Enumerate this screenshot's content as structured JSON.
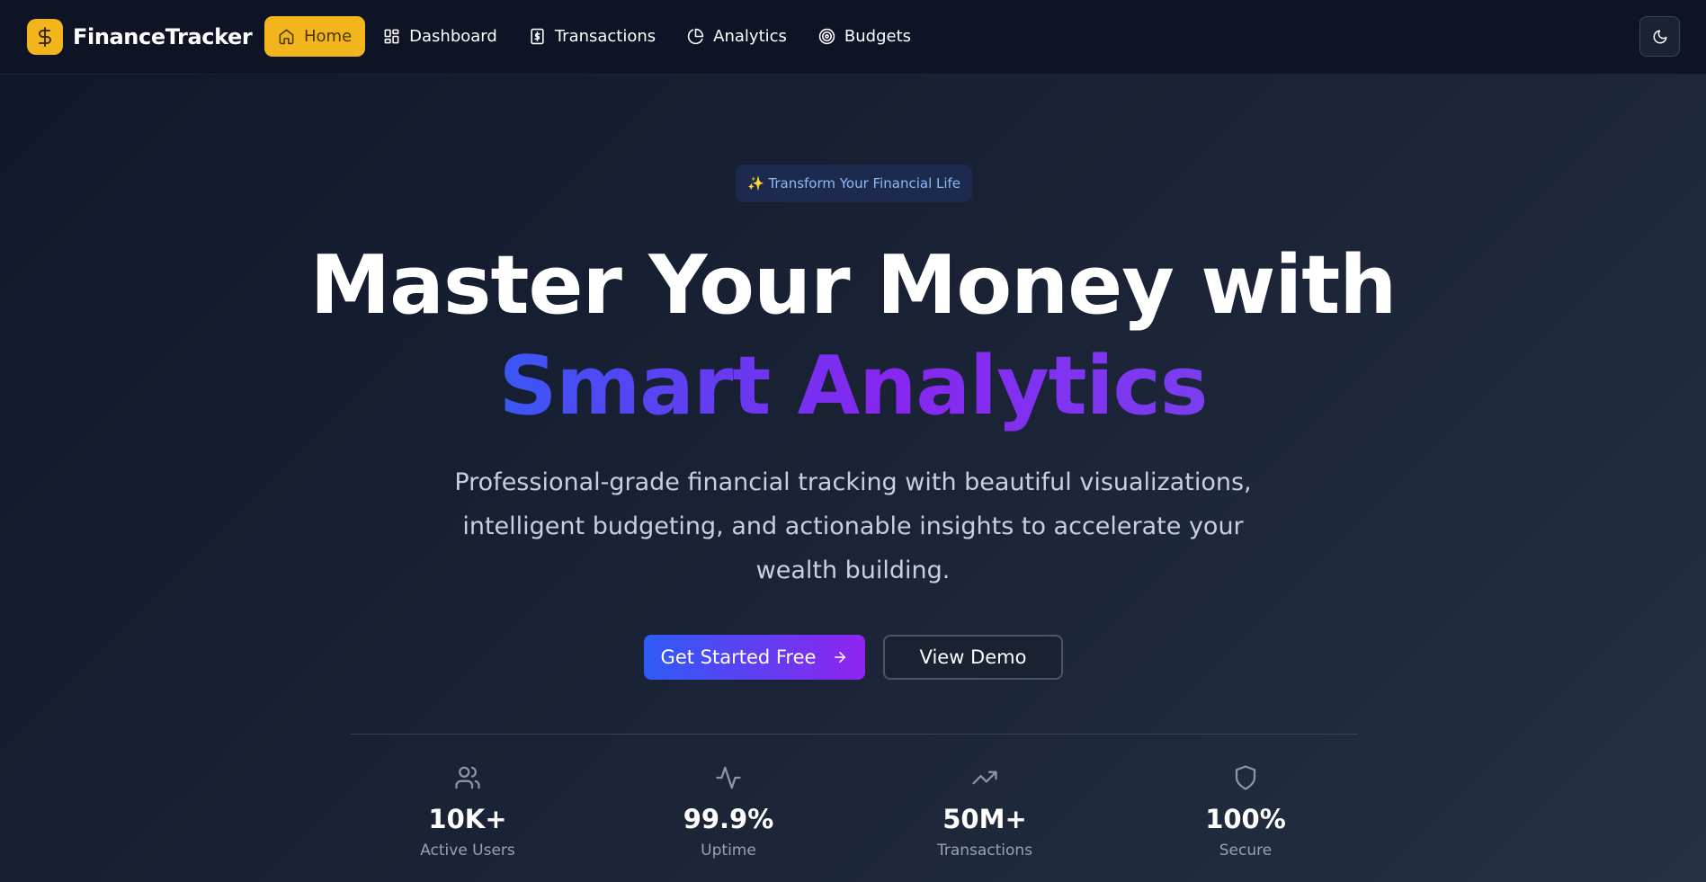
{
  "nav": {
    "brand": "FinanceTracker",
    "logo_icon": "dollar-icon",
    "items": [
      {
        "label": "Home",
        "icon": "home-icon",
        "active": true
      },
      {
        "label": "Dashboard",
        "icon": "dashboard-icon",
        "active": false
      },
      {
        "label": "Transactions",
        "icon": "receipt-icon",
        "active": false
      },
      {
        "label": "Analytics",
        "icon": "pie-chart-icon",
        "active": false
      },
      {
        "label": "Budgets",
        "icon": "target-icon",
        "active": false
      }
    ],
    "theme_toggle_icon": "moon-icon"
  },
  "hero": {
    "badge": "✨ Transform Your Financial Life",
    "title_line1": "Master Your Money with",
    "title_line2": "Smart Analytics",
    "subtitle": "Professional-grade financial tracking with beautiful visualizations, intelligent budgeting, and actionable insights to accelerate your wealth building.",
    "primary_cta": "Get Started Free",
    "secondary_cta": "View Demo"
  },
  "stats": [
    {
      "value": "10K+",
      "label": "Active Users",
      "icon": "users-icon"
    },
    {
      "value": "99.9%",
      "label": "Uptime",
      "icon": "activity-icon"
    },
    {
      "value": "50M+",
      "label": "Transactions",
      "icon": "trending-up-icon"
    },
    {
      "value": "100%",
      "label": "Secure",
      "icon": "shield-icon"
    }
  ],
  "colors": {
    "background": "#0f172a",
    "accent": "#f2b51b",
    "gradient_start": "#2d5bf5",
    "gradient_end": "#9024f0",
    "badge_text": "#8fb8f6"
  }
}
